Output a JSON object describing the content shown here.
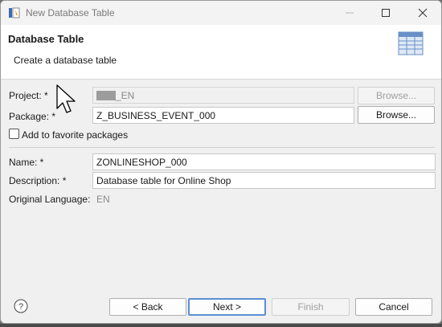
{
  "window": {
    "title": "New Database Table",
    "app_icon": "eclipse-wizard-icon",
    "controls": {
      "minimize": "minimize-icon",
      "maximize": "maximize-icon",
      "close": "close-icon"
    }
  },
  "banner": {
    "title": "Database Table",
    "subtitle": "Create a database table",
    "icon": "database-table-icon"
  },
  "form": {
    "project": {
      "label": "Project: *",
      "value": "_EN",
      "browse_label": "Browse..."
    },
    "package": {
      "label": "Package: *",
      "value": "Z_BUSINESS_EVENT_000",
      "browse_label": "Browse..."
    },
    "favorite": {
      "label": "Add to favorite packages",
      "checked": false
    },
    "name": {
      "label": "Name: *",
      "value": "ZONLINESHOP_000"
    },
    "description": {
      "label": "Description: *",
      "value": "Database table for Online Shop"
    },
    "original_language": {
      "label": "Original Language:",
      "value": "EN"
    }
  },
  "footer": {
    "help_icon": "help-icon",
    "back_label": "< Back",
    "next_label": "Next >",
    "finish_label": "Finish",
    "cancel_label": "Cancel"
  },
  "colors": {
    "default_button_border": "#5b8ed6",
    "window_bg": "#f0f0f0",
    "banner_bg": "#ffffff"
  }
}
